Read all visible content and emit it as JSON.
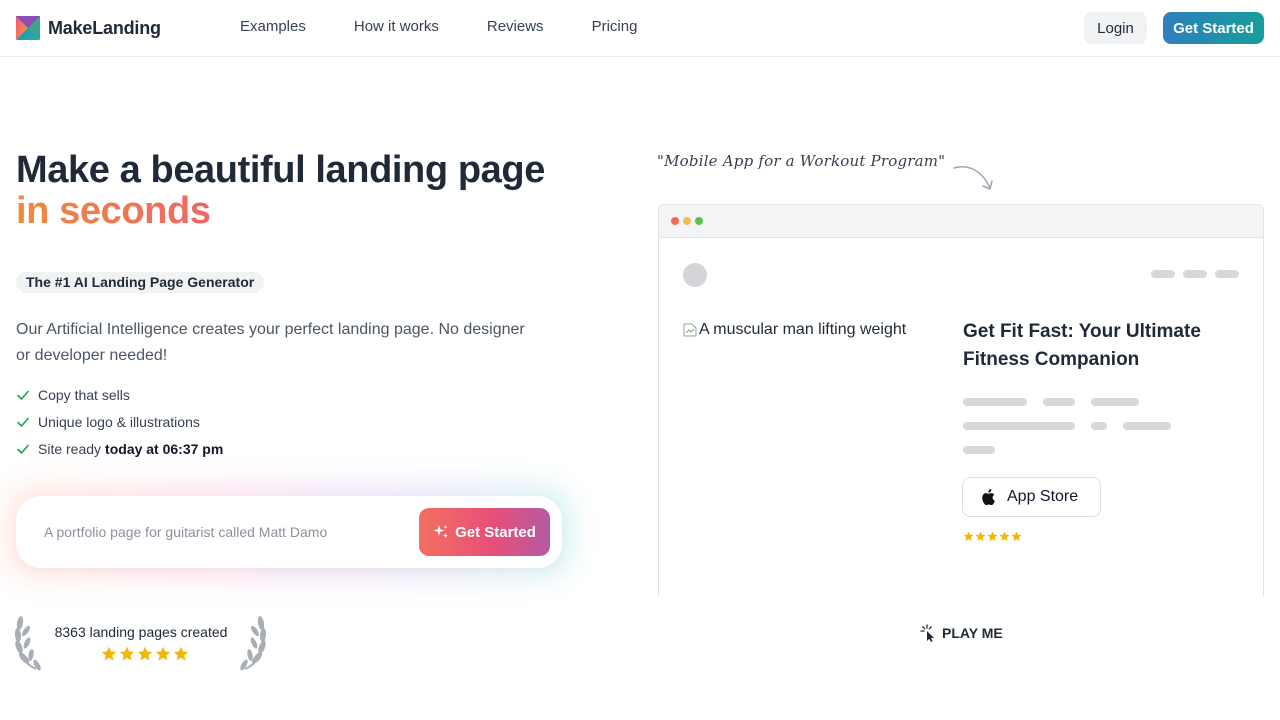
{
  "nav": {
    "brand": "MakeLanding",
    "links": [
      "Examples",
      "How it works",
      "Reviews",
      "Pricing"
    ],
    "login": "Login",
    "cta": "Get Started"
  },
  "hero": {
    "title_line1": "Make a beautiful landing page",
    "title_line2": "in seconds",
    "badge": "The #1 AI Landing Page Generator",
    "lead": "Our Artificial Intelligence creates your perfect landing page. No designer or developer needed!",
    "checks": [
      "Copy that sells",
      "Unique logo & illustrations",
      "Site ready"
    ],
    "ready_time": "today at 06:37 pm"
  },
  "prompt": {
    "placeholder": "A portfolio page for guitarist called Matt Damo",
    "button": "Get Started"
  },
  "proof": {
    "created": "8363 landing pages created",
    "rating": 5
  },
  "preview": {
    "note": "\"Mobile App for a Workout Program\"",
    "image_alt": "A muscular man lifting weight",
    "title": "Get Fit Fast: Your Ultimate Fitness Companion",
    "app_store": "App Store",
    "rating": 5
  },
  "play": {
    "label": "PLAY ME"
  },
  "colors": {
    "accent_gradient_start": "#2f7fbd",
    "accent_gradient_end": "#179e9b",
    "warm_gradient_start": "#f08a3e",
    "warm_gradient_end": "#e4467e",
    "star": "#f2b705",
    "check": "#22a35a"
  },
  "icons": [
    "brand-logo-icon",
    "check-icon",
    "sparkle-icon",
    "laurel-icon",
    "star-icon",
    "arrow-icon",
    "broken-image-icon",
    "apple-icon",
    "pointer-click-icon"
  ]
}
